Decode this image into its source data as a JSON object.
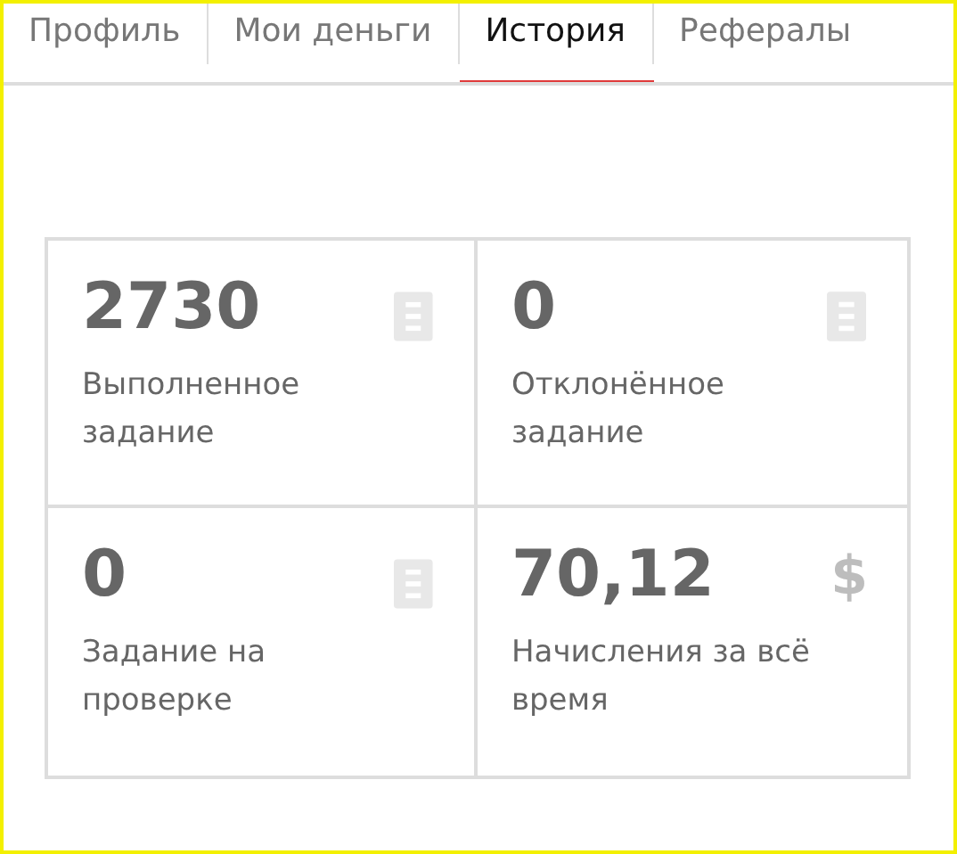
{
  "tabs": [
    {
      "label": "Профиль",
      "selected": false
    },
    {
      "label": "Мои деньги",
      "selected": false
    },
    {
      "label": "История",
      "selected": true
    },
    {
      "label": "Рефералы",
      "selected": false
    }
  ],
  "stats": [
    {
      "value": "2730",
      "label": "Выполненное задание",
      "kind": "document"
    },
    {
      "value": "0",
      "label": "Отклонённое задание",
      "kind": "document"
    },
    {
      "value": "0",
      "label": "Задание на проверке",
      "kind": "document"
    },
    {
      "value": "70,12",
      "label": "Начисления за всё время",
      "kind": "currency",
      "icon_text": "$"
    }
  ]
}
